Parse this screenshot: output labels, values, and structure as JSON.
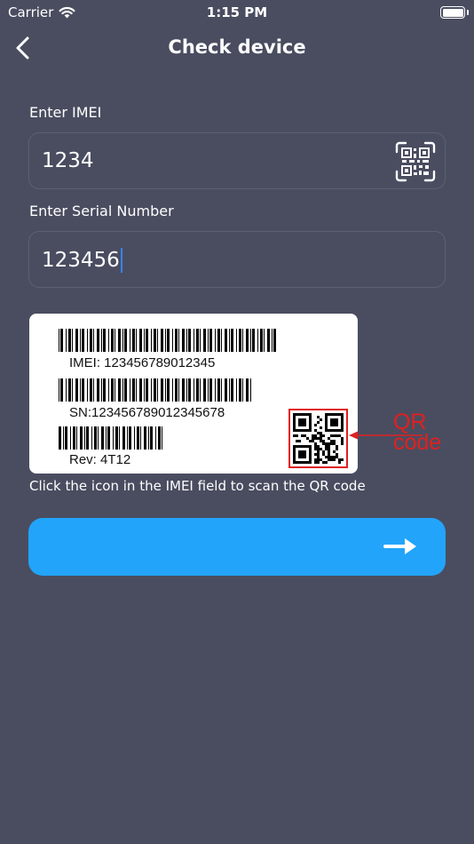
{
  "status_bar": {
    "carrier": "Carrier",
    "time": "1:15 PM"
  },
  "nav": {
    "title": "Check device",
    "back_icon": "chevron-left-icon"
  },
  "imei_field": {
    "label": "Enter IMEI",
    "value": "1234",
    "scan_icon": "qr-scan-icon"
  },
  "serial_field": {
    "label": "Enter Serial Number",
    "value": "123456"
  },
  "label_image": {
    "imei_line": "IMEI:  123456789012345",
    "sn_line": "SN:123456789012345678",
    "rev_line": "Rev:  4T12",
    "callout_line1": "QR",
    "callout_line2": "code"
  },
  "hint": "Click the icon in the IMEI field to scan the QR code",
  "next_button": {
    "icon": "arrow-right-icon"
  },
  "colors": {
    "background": "#4a4d60",
    "accent": "#22a4fb",
    "callout": "#e02020",
    "cursor": "#3b82f6"
  }
}
